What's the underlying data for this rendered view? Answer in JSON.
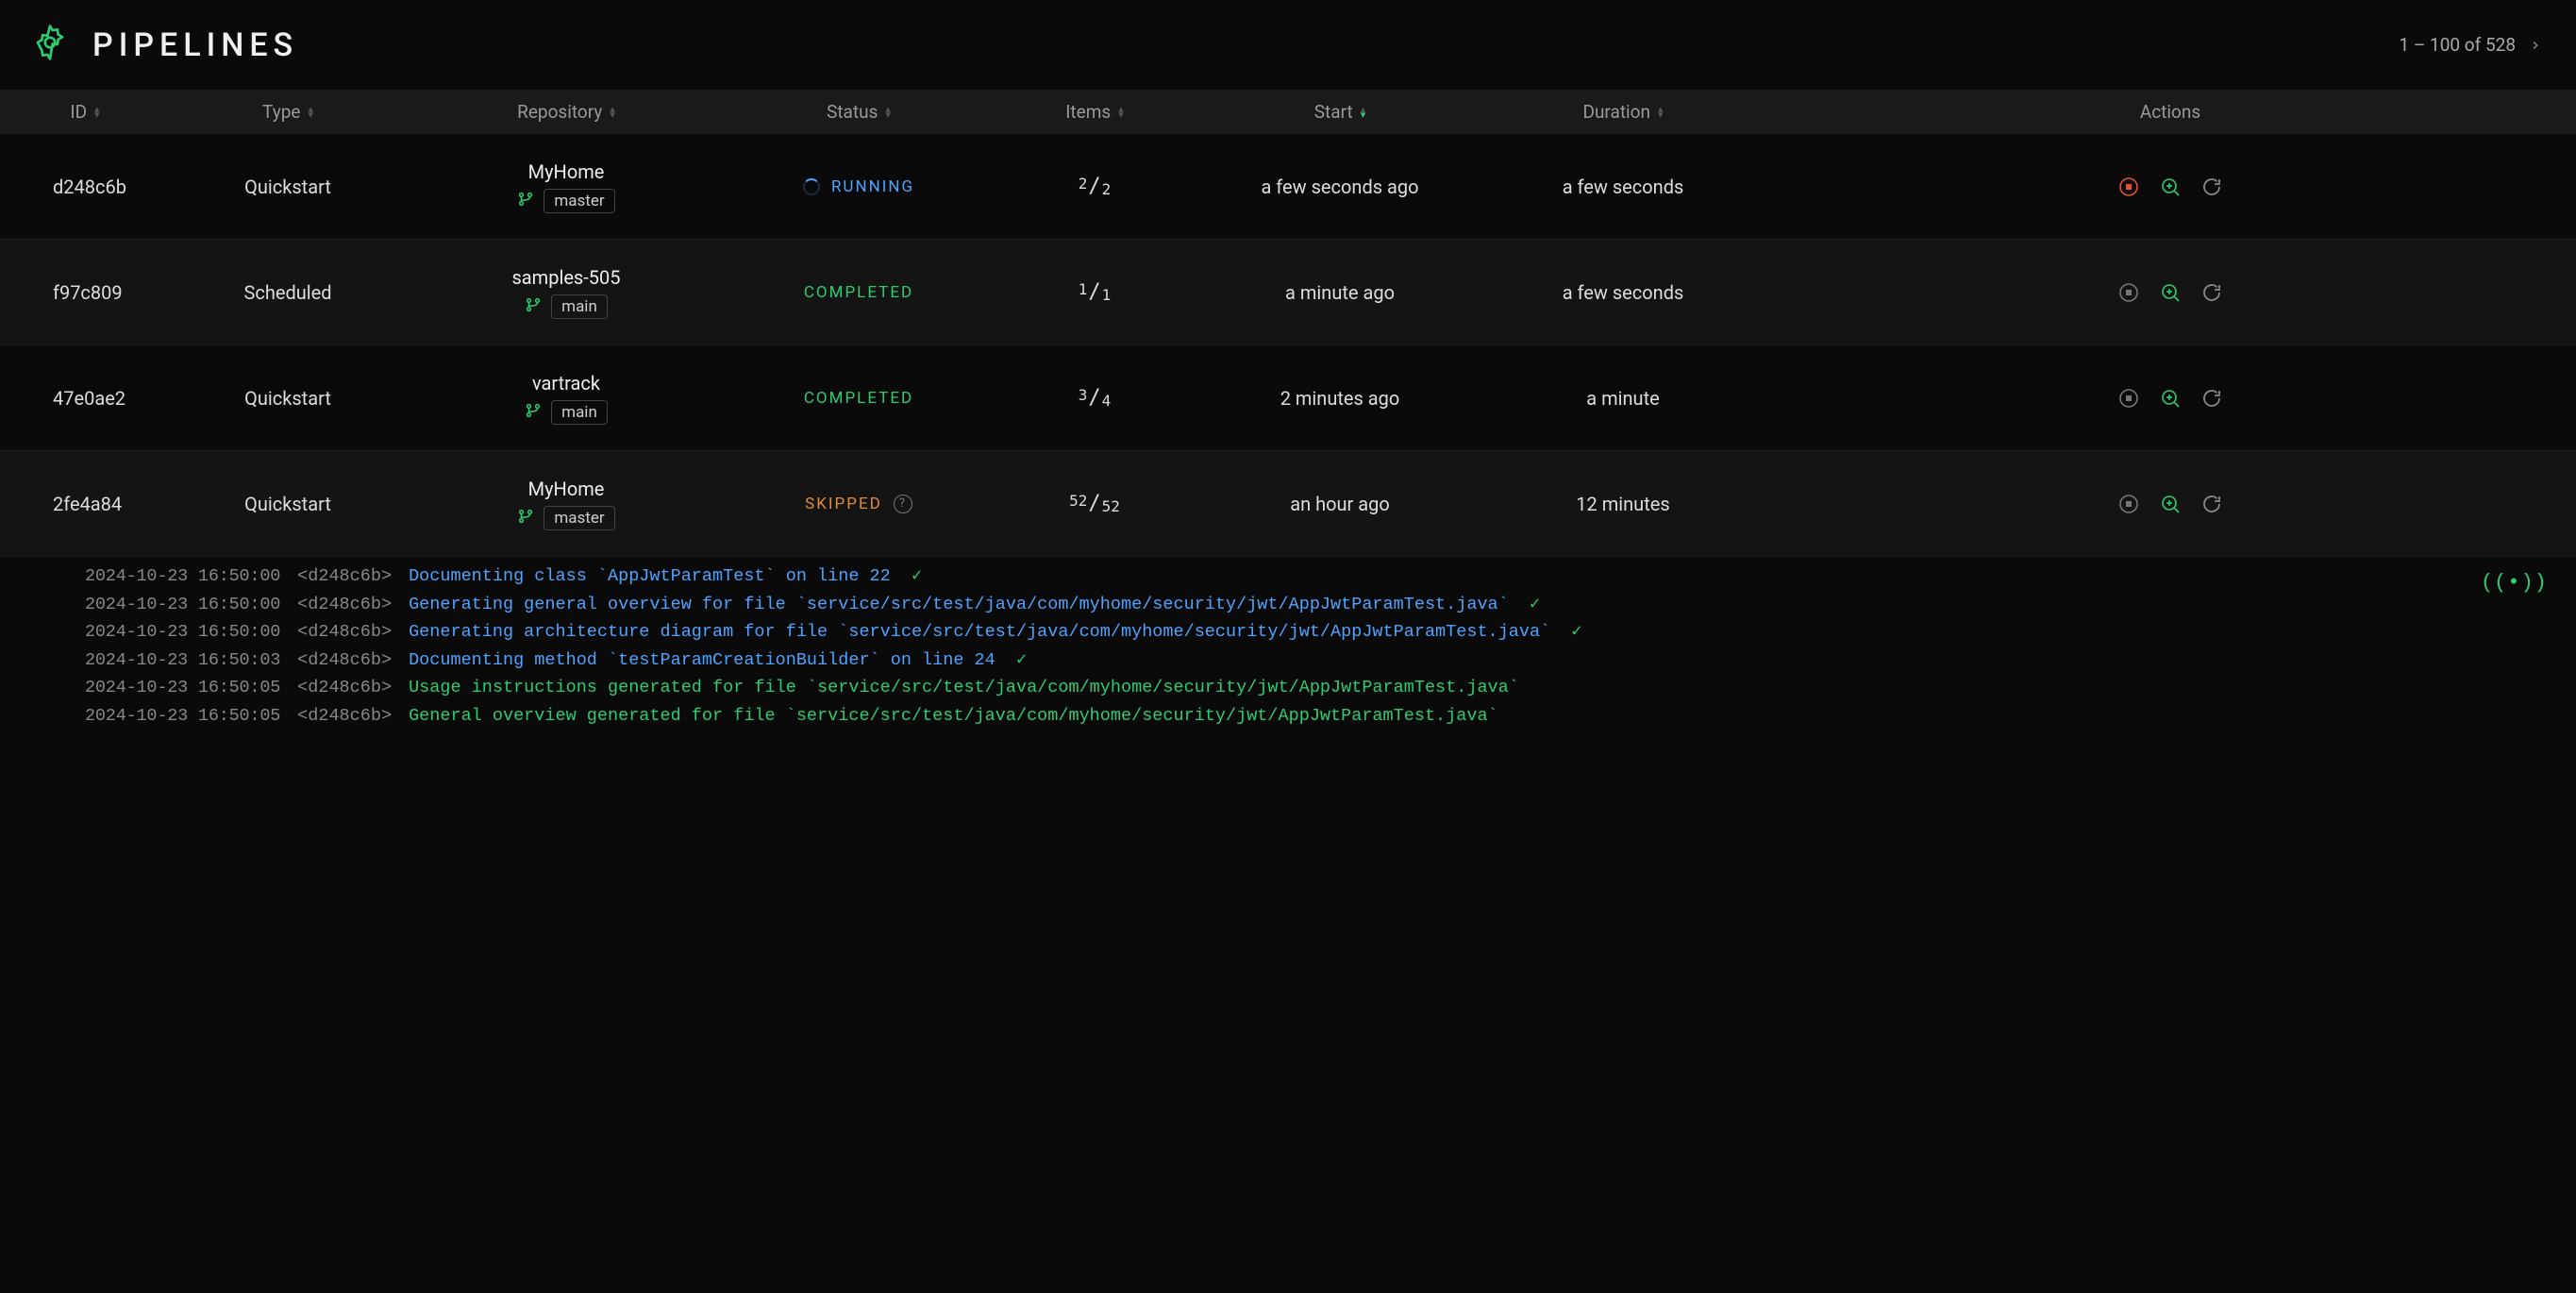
{
  "header": {
    "title": "PIPELINES",
    "pager": "1 – 100 of 528"
  },
  "columns": {
    "id": "ID",
    "type": "Type",
    "repository": "Repository",
    "status": "Status",
    "items": "Items",
    "start": "Start",
    "duration": "Duration",
    "actions": "Actions"
  },
  "rows": [
    {
      "id": "d248c6b",
      "type": "Quickstart",
      "repo": "MyHome",
      "branch": "master",
      "status": "RUNNING",
      "status_kind": "running",
      "items_num": "2",
      "items_den": "2",
      "start": "a few seconds ago",
      "duration": "a few seconds",
      "stop_active": true
    },
    {
      "id": "f97c809",
      "type": "Scheduled",
      "repo": "samples-505",
      "branch": "main",
      "status": "COMPLETED",
      "status_kind": "completed",
      "items_num": "1",
      "items_den": "1",
      "start": "a minute ago",
      "duration": "a few seconds",
      "stop_active": false
    },
    {
      "id": "47e0ae2",
      "type": "Quickstart",
      "repo": "vartrack",
      "branch": "main",
      "status": "COMPLETED",
      "status_kind": "completed",
      "items_num": "3",
      "items_den": "4",
      "start": "2 minutes ago",
      "duration": "a minute",
      "stop_active": false
    },
    {
      "id": "2fe4a84",
      "type": "Quickstart",
      "repo": "MyHome",
      "branch": "master",
      "status": "SKIPPED",
      "status_kind": "skipped",
      "items_num": "52",
      "items_den": "52",
      "start": "an hour ago",
      "duration": "12 minutes",
      "stop_active": false
    }
  ],
  "log": [
    {
      "ts": "2024-10-23 16:50:00",
      "hash": "<d248c6b>",
      "msg": "Documenting class `AppJwtParamTest` on line 22",
      "kind": "blue",
      "check": true
    },
    {
      "ts": "2024-10-23 16:50:00",
      "hash": "<d248c6b>",
      "msg": "Generating general overview for file `service/src/test/java/com/myhome/security/jwt/AppJwtParamTest.java`",
      "kind": "blue",
      "check": true
    },
    {
      "ts": "2024-10-23 16:50:00",
      "hash": "<d248c6b>",
      "msg": "Generating architecture diagram for file `service/src/test/java/com/myhome/security/jwt/AppJwtParamTest.java`",
      "kind": "blue",
      "check": true
    },
    {
      "ts": "2024-10-23 16:50:03",
      "hash": "<d248c6b>",
      "msg": "Documenting method `testParamCreationBuilder` on line 24",
      "kind": "blue",
      "check": true
    },
    {
      "ts": "2024-10-23 16:50:05",
      "hash": "<d248c6b>",
      "msg": "Usage instructions generated for file `service/src/test/java/com/myhome/security/jwt/AppJwtParamTest.java`",
      "kind": "green",
      "check": false
    },
    {
      "ts": "2024-10-23 16:50:05",
      "hash": "<d248c6b>",
      "msg": "General overview generated for file `service/src/test/java/com/myhome/security/jwt/AppJwtParamTest.java`",
      "kind": "green",
      "check": false
    }
  ],
  "log_badge": "((•))"
}
